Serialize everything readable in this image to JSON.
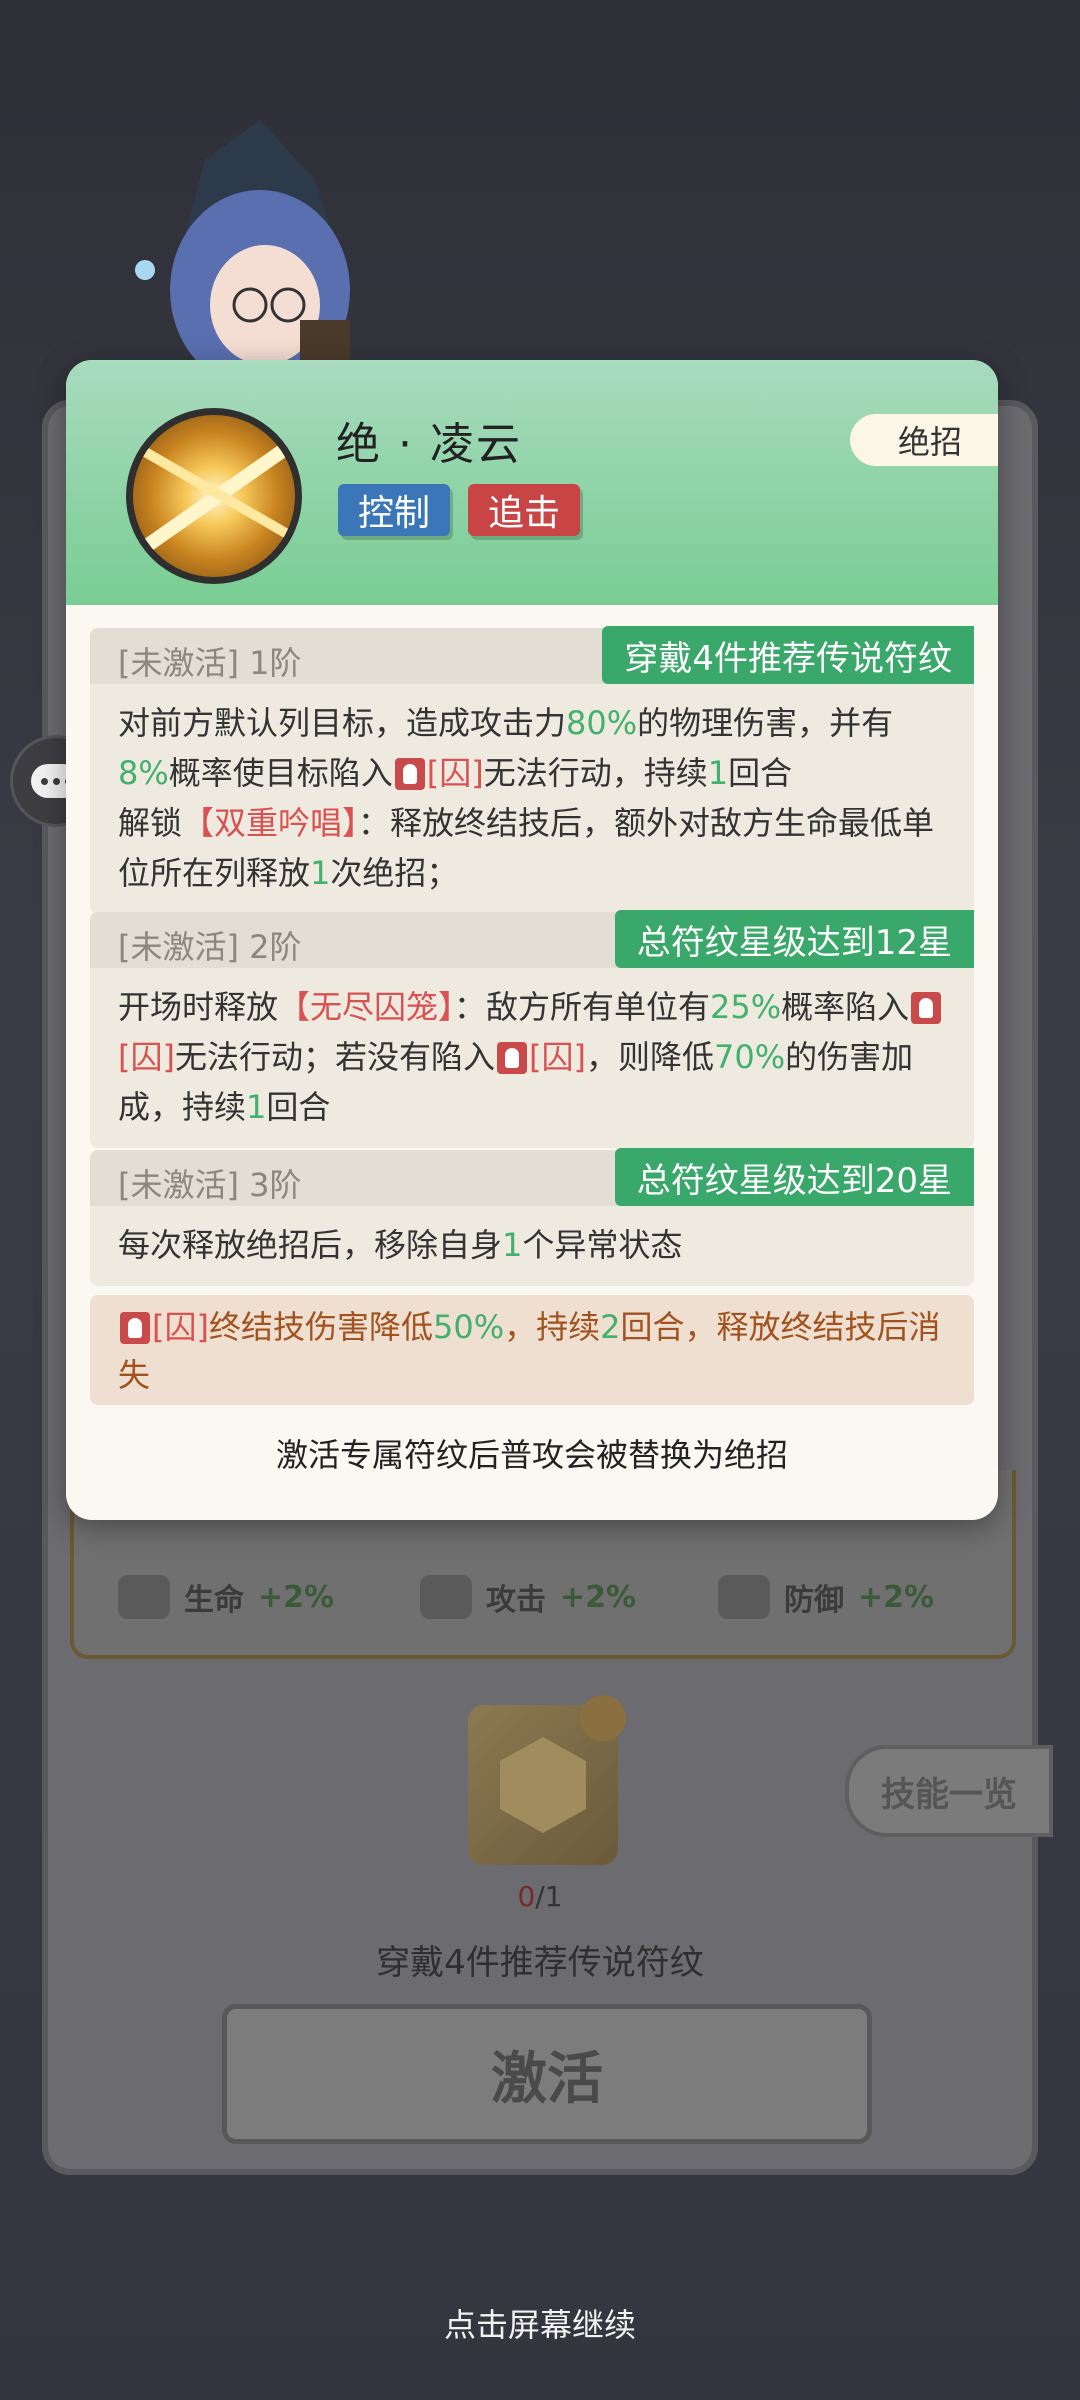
{
  "skill": {
    "name": "绝 · 凌云",
    "tags": [
      "控制",
      "追击"
    ],
    "badge": "绝招"
  },
  "tiers": [
    {
      "state": "[未激活]",
      "level": "1阶",
      "requirement": "穿戴4件推荐传说符纹",
      "text": {
        "a1": "对前方默认列目标，造成攻击力",
        "v1": "80%",
        "a2": "的物理伤害，并有",
        "v2": "8%",
        "a3": "概率使目标陷入",
        "seal": "[囚]",
        "a4": "无法行动，持续",
        "v3": "1",
        "a5": "回合",
        "a6": "解锁",
        "unlock": "【双重吟唱】",
        "a7": "：释放终结技后，额外对敌方生命最低单位所在列释放",
        "v4": "1",
        "a8": "次绝招；"
      }
    },
    {
      "state": "[未激活]",
      "level": "2阶",
      "requirement": "总符纹星级达到12星",
      "text": {
        "a1": "开场时释放",
        "skill": "【无尽囚笼】",
        "a2": "：敌方所有单位有",
        "v1": "25%",
        "a3": "概率陷入",
        "seal": "[囚]",
        "a4": "无法行动；若没有陷入",
        "seal2": "[囚]",
        "a5": "，则降低",
        "v2": "70%",
        "a6": "的伤害加成，持续",
        "v3": "1",
        "a7": "回合"
      }
    },
    {
      "state": "[未激活]",
      "level": "3阶",
      "requirement": "总符纹星级达到20星",
      "text": {
        "a1": "每次释放绝招后，移除自身",
        "v1": "1",
        "a2": "个异常状态"
      }
    }
  ],
  "notice": {
    "seal": "[囚]",
    "a1": "终结技伤害降低",
    "v1": "50%",
    "a2": "，持续",
    "v2": "2",
    "a3": "回合，释放终结技后消失"
  },
  "footer": "激活专属符纹后普攻会被替换为绝招",
  "chat": {
    "count": "3"
  },
  "background": {
    "stats": [
      {
        "label": "生命",
        "value": "+2%"
      },
      {
        "label": "攻击",
        "value": "+2%"
      },
      {
        "label": "防御",
        "value": "+2%"
      }
    ],
    "skill_list": "技能一览",
    "rune_have": "0",
    "rune_total": "/1",
    "rune_need": "穿戴4件推荐传说符纹",
    "activate": "激活"
  },
  "continue_hint": "点击屏幕继续"
}
